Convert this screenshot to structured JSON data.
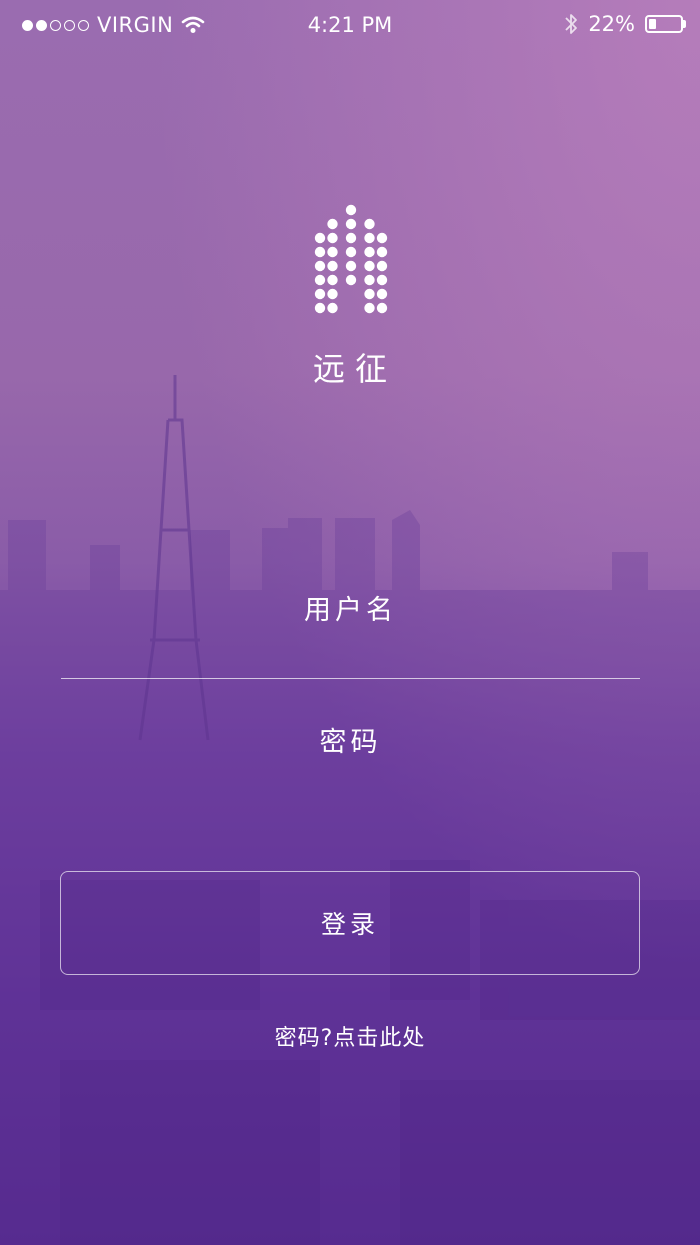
{
  "status_bar": {
    "carrier": "VIRGIN",
    "time": "4:21 PM",
    "battery_percent": "22%",
    "battery_level": 0.22,
    "signal_bars_filled": 2,
    "signal_bars_total": 5
  },
  "app": {
    "name": "远征",
    "logo_icon": "dotted-arch-logo-icon"
  },
  "form": {
    "username_placeholder": "用户名",
    "password_placeholder": "密码",
    "login_label": "登录",
    "forgot_link": "密码?点击此处"
  },
  "colors": {
    "background_top": "#9a6cb0",
    "background_bottom": "#4c2189",
    "text": "#ffffff"
  }
}
